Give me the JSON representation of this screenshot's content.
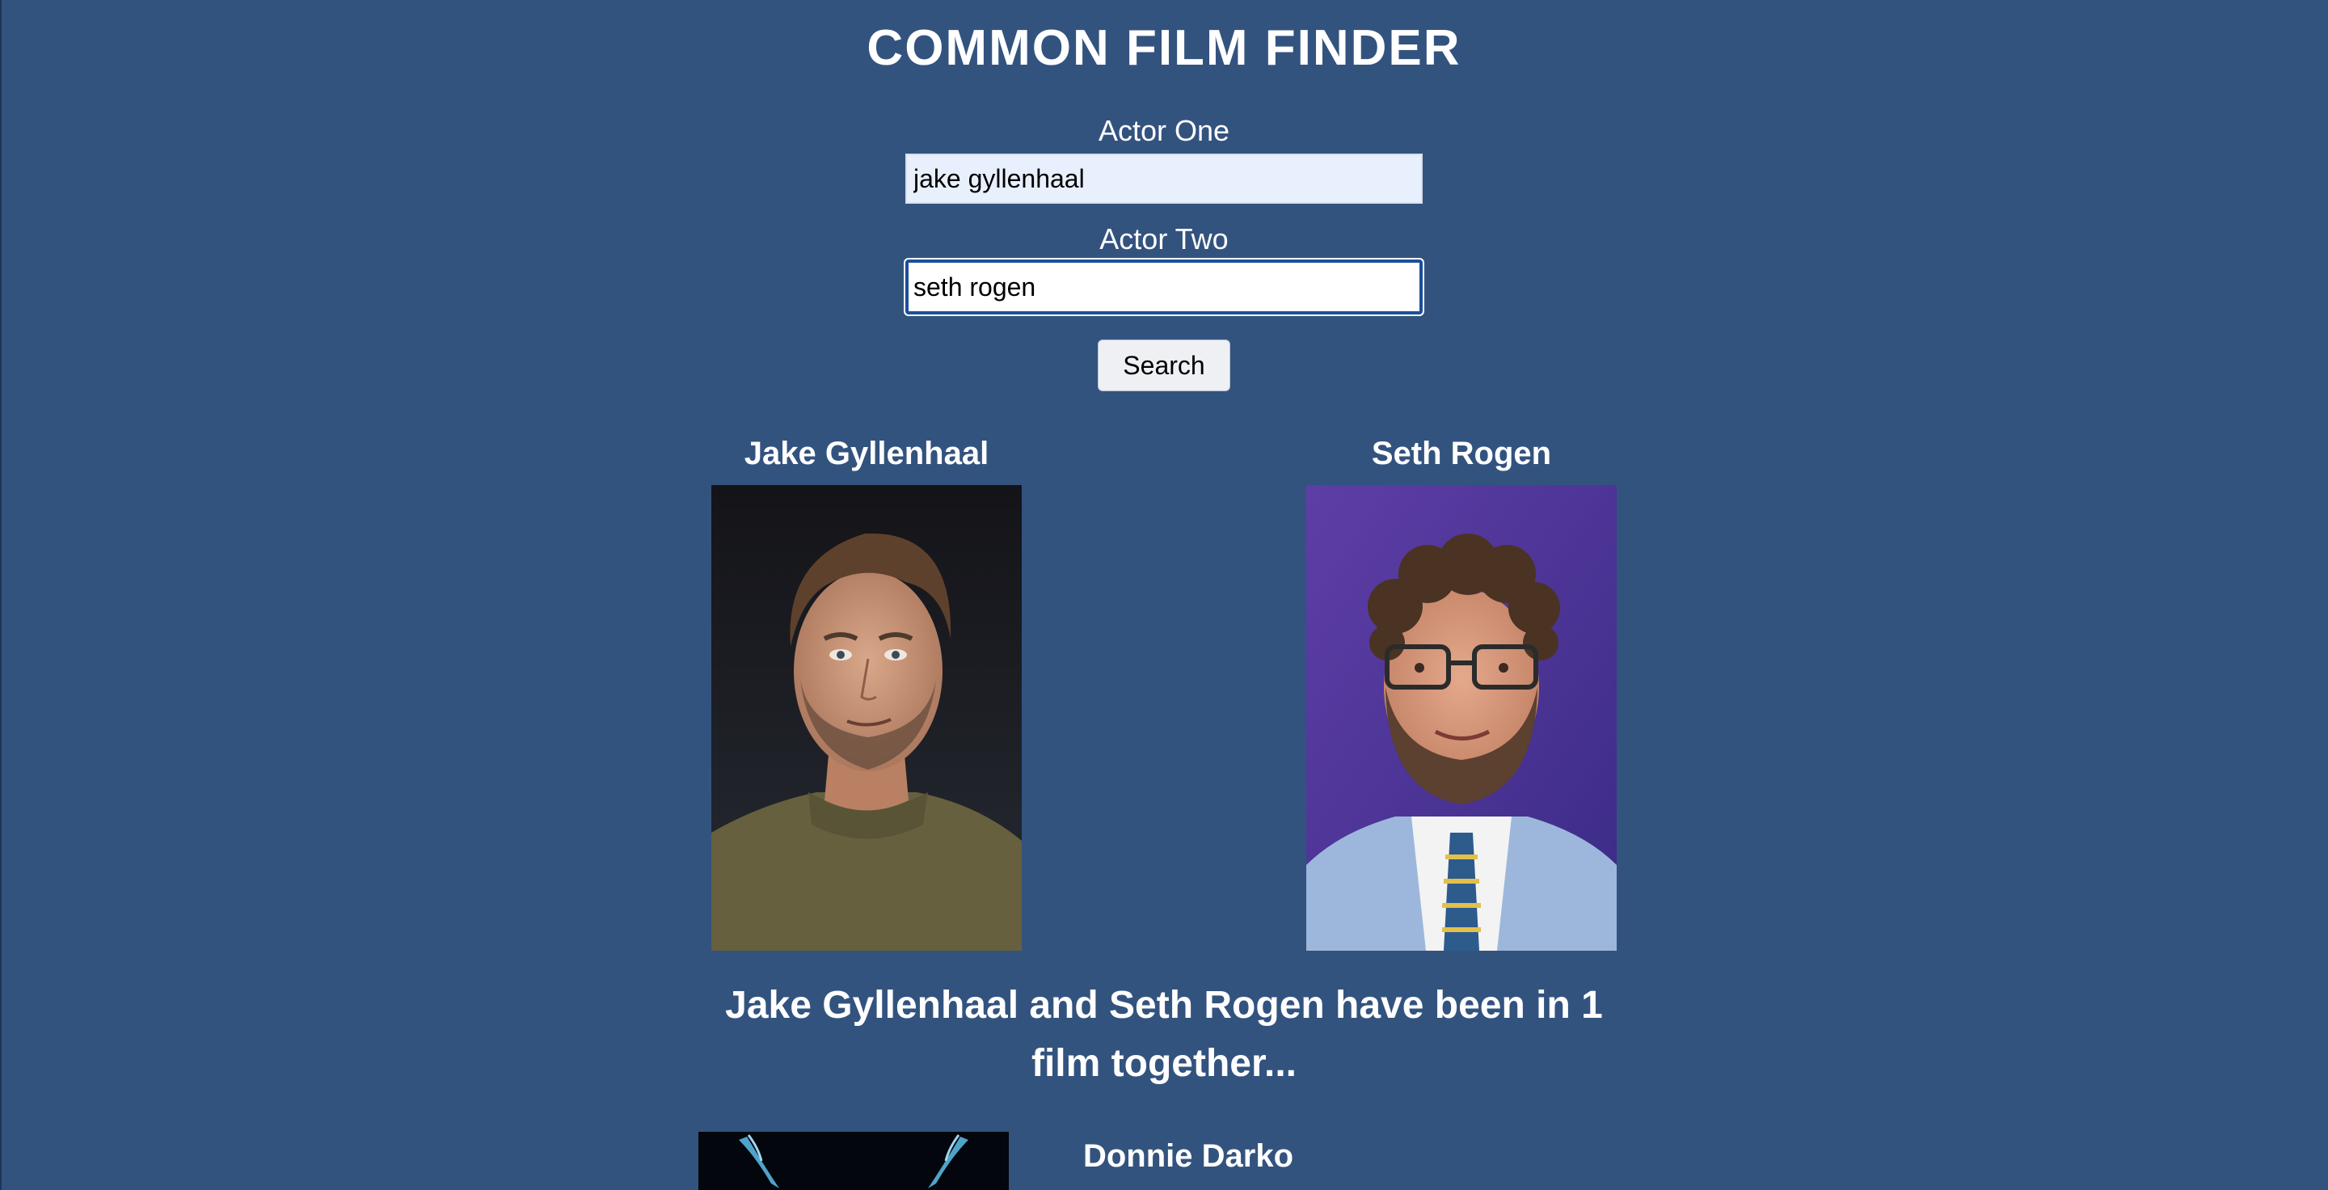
{
  "app": {
    "title": "COMMON FILM FINDER"
  },
  "form": {
    "actor_one_label": "Actor One",
    "actor_one_value": "jake gyllenhaal",
    "actor_two_label": "Actor Two",
    "actor_two_value": "seth rogen",
    "search_label": "Search"
  },
  "actors": [
    {
      "name": "Jake Gyllenhaal"
    },
    {
      "name": "Seth Rogen"
    }
  ],
  "result": {
    "summary": "Jake Gyllenhaal and Seth Rogen have been in 1 film together..."
  },
  "films": [
    {
      "title": "Donnie Darko"
    }
  ],
  "colors": {
    "background": "#33537f",
    "text": "#ffffff",
    "input_bg": "#e8f0fe",
    "focus_border": "#1c4f9a"
  }
}
